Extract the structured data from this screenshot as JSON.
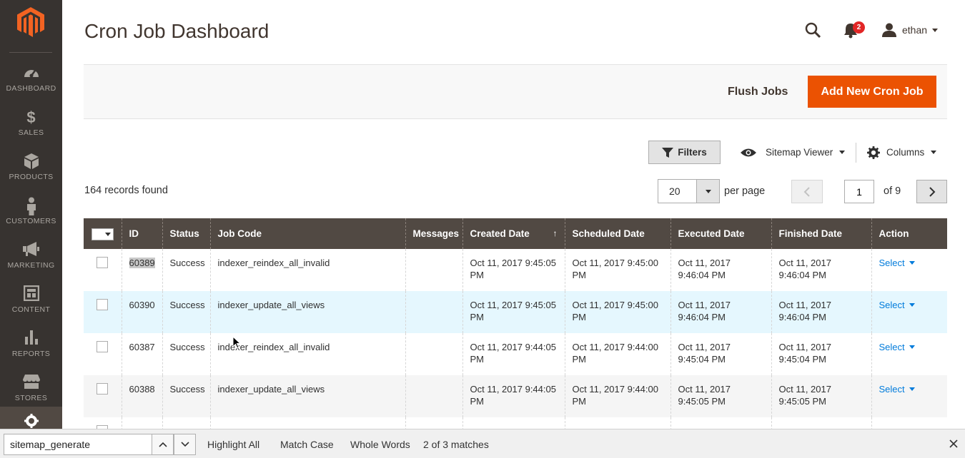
{
  "sidebar": {
    "items": [
      {
        "label": "DASHBOARD",
        "icon": "dashboard-icon"
      },
      {
        "label": "SALES",
        "icon": "dollar-icon"
      },
      {
        "label": "PRODUCTS",
        "icon": "box-icon"
      },
      {
        "label": "CUSTOMERS",
        "icon": "person-icon"
      },
      {
        "label": "MARKETING",
        "icon": "megaphone-icon"
      },
      {
        "label": "CONTENT",
        "icon": "layout-icon"
      },
      {
        "label": "REPORTS",
        "icon": "bar-chart-icon"
      },
      {
        "label": "STORES",
        "icon": "store-icon"
      }
    ]
  },
  "header": {
    "title": "Cron Job Dashboard",
    "notifications_count": "2",
    "username": "ethan"
  },
  "actions": {
    "flush_label": "Flush Jobs",
    "add_label": "Add New Cron Job"
  },
  "grid_controls": {
    "filters_label": "Filters",
    "view_label": "Sitemap Viewer",
    "columns_label": "Columns",
    "records_found": "164 records found",
    "per_page_value": "20",
    "per_page_label": "per page",
    "current_page": "1",
    "total_pages_label": "of 9"
  },
  "table": {
    "headers": {
      "id": "ID",
      "status": "Status",
      "job_code": "Job Code",
      "messages": "Messages",
      "created": "Created Date",
      "created_sort": "↑",
      "scheduled": "Scheduled Date",
      "executed": "Executed Date",
      "finished": "Finished Date",
      "action": "Action"
    },
    "rows": [
      {
        "id": "60389",
        "status": "Success",
        "job_code": "indexer_reindex_all_invalid",
        "messages": "",
        "created": "Oct 11, 2017 9:45:05 PM",
        "scheduled": "Oct 11, 2017 9:45:00 PM",
        "executed": "Oct 11, 2017 9:46:04 PM",
        "finished": "Oct 11, 2017 9:46:04 PM",
        "action": "Select"
      },
      {
        "id": "60390",
        "status": "Success",
        "job_code": "indexer_update_all_views",
        "messages": "",
        "created": "Oct 11, 2017 9:45:05 PM",
        "scheduled": "Oct 11, 2017 9:45:00 PM",
        "executed": "Oct 11, 2017 9:46:04 PM",
        "finished": "Oct 11, 2017 9:46:04 PM",
        "action": "Select"
      },
      {
        "id": "60387",
        "status": "Success",
        "job_code": "indexer_reindex_all_invalid",
        "messages": "",
        "created": "Oct 11, 2017 9:44:05 PM",
        "scheduled": "Oct 11, 2017 9:44:00 PM",
        "executed": "Oct 11, 2017 9:45:04 PM",
        "finished": "Oct 11, 2017 9:45:04 PM",
        "action": "Select"
      },
      {
        "id": "60388",
        "status": "Success",
        "job_code": "indexer_update_all_views",
        "messages": "",
        "created": "Oct 11, 2017 9:44:05 PM",
        "scheduled": "Oct 11, 2017 9:44:00 PM",
        "executed": "Oct 11, 2017 9:45:05 PM",
        "finished": "Oct 11, 2017 9:45:05 PM",
        "action": "Select"
      }
    ]
  },
  "findbar": {
    "query": "sitemap_generate",
    "highlight_all": "Highlight All",
    "match_case": "Match Case",
    "whole_words": "Whole Words",
    "status": "2 of 3 matches"
  },
  "colors": {
    "sidebar_bg": "#373330",
    "accent_orange": "#eb5202",
    "table_header_bg": "#514943",
    "link_blue": "#007bdb",
    "row_hover": "#e5f7fe"
  }
}
